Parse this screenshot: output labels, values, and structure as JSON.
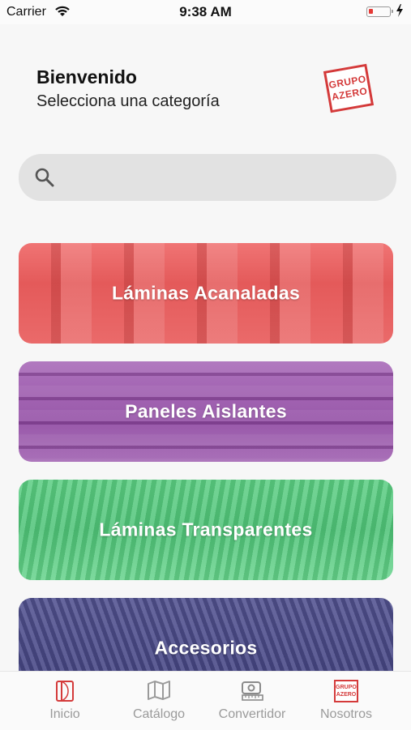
{
  "status_bar": {
    "carrier": "Carrier",
    "time": "9:38 AM"
  },
  "header": {
    "title": "Bienvenido",
    "subtitle": "Selecciona una categoría",
    "logo_line1": "GRUPO",
    "logo_line2": "AZERO"
  },
  "search": {
    "placeholder": ""
  },
  "categories": [
    {
      "label": "Láminas Acanaladas",
      "color": "#e95f5f"
    },
    {
      "label": "Paneles Aislantes",
      "color": "#9b59b0"
    },
    {
      "label": "Láminas Transparentes",
      "color": "#58c980"
    },
    {
      "label": "Accesorios",
      "color": "#4f4f8c"
    }
  ],
  "tabbar": {
    "tabs": [
      {
        "label": "Inicio",
        "icon": "home-page-icon",
        "active": true
      },
      {
        "label": "Catálogo",
        "icon": "map-icon"
      },
      {
        "label": "Convertidor",
        "icon": "tape-measure-icon"
      },
      {
        "label": "Nosotros",
        "icon": "grupo-azero-logo-icon"
      }
    ],
    "active_color": "#d43a3a"
  }
}
